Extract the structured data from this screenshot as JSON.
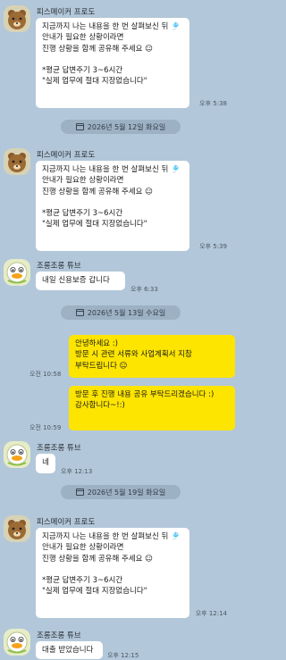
{
  "colors": {
    "background": "#b2c7d9",
    "bubble_received": "#ffffff",
    "bubble_sent": "#fee500"
  },
  "messages": [
    {
      "type": "received",
      "sender": "피스메이커 프로도",
      "avatar": "brown-bear-icon",
      "text": "지금까지 나는 내용을 한 번 살펴보신 뒤 🎐\n안내가 필요한 상황이라면\n진행 상황을 함께 공유해 주세요 ☺\n\n*평균 답변주기 3~6시간\n\"실제 업무에 절대 지장없습니다\"",
      "time": "오후 5:38"
    },
    {
      "type": "date",
      "text": "2026년 5월 12일 화요일"
    },
    {
      "type": "received",
      "sender": "피스메이커 프로도",
      "avatar": "brown-bear-icon",
      "text": "지금까지 나는 내용을 한 번 살펴보신 뒤 🎐\n안내가 필요한 상황이라면\n진행 상황을 함께 공유해 주세요 ☺\n\n*평균 답변주기 3~6시간\n\"실제 업무에 절대 지장없습니다\"",
      "time": "오후 5:39"
    },
    {
      "type": "received",
      "sender": "조롱조롱 튜브",
      "avatar": "duck-icon",
      "text": "내일 신용보증 갑니다",
      "time": "오후 6:33"
    },
    {
      "type": "date",
      "text": "2026년 5월 13일 수요일"
    },
    {
      "type": "sent",
      "text": "안녕하세요 :)\n방문 시 관련 서류와 사업계획서 지참 부탁드립니다 ☺",
      "time": "오전 10:58"
    },
    {
      "type": "sent",
      "text": "방문 후 진행 내용 공유 부탁드리겠습니다 :)\n감사합니다~!:)",
      "time": "오전 10:59"
    },
    {
      "type": "received",
      "sender": "조롱조롱 튜브",
      "avatar": "duck-icon",
      "text": "네",
      "time": "오후 12:13"
    },
    {
      "type": "date",
      "text": "2026년 5월 19일 화요일"
    },
    {
      "type": "received",
      "sender": "피스메이커 프로도",
      "avatar": "brown-bear-icon",
      "text": "지금까지 나는 내용을 한 번 살펴보신 뒤 🎐\n안내가 필요한 상황이라면\n진행 상황을 함께 공유해 주세요 ☺\n\n*평균 답변주기 3~6시간\n\"실제 업무에 절대 지장없습니다\"",
      "time": "오후 12:14"
    },
    {
      "type": "received",
      "sender": "조롱조롱 튜브",
      "avatar": "duck-icon",
      "text": "대출 받았습니다",
      "time": "오후 12:15"
    }
  ]
}
